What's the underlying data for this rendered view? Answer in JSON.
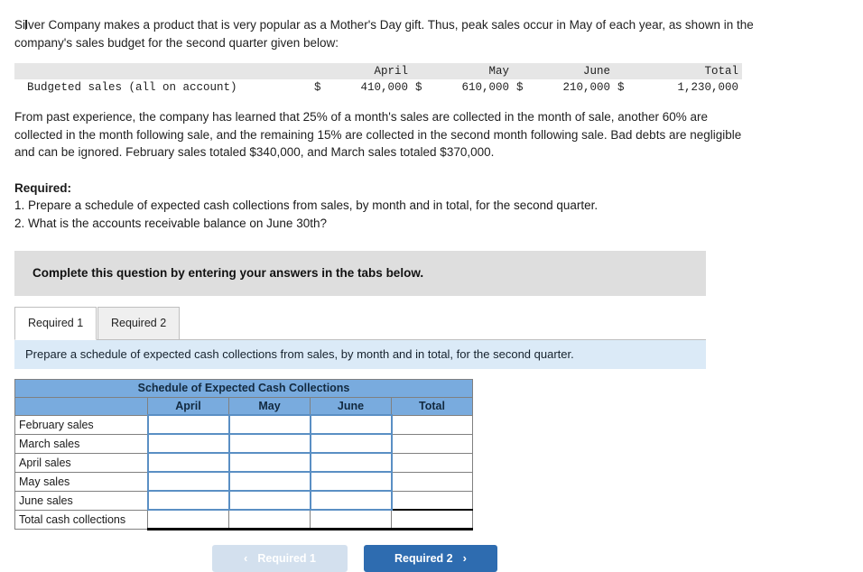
{
  "intro": {
    "paragraph1_a": "Si",
    "paragraph1_b": "lver Company makes a product that is very popular as a Mother's Day gift. Thus, peak sales occur in May of each year, as shown in the company's sales budget for the second quarter given below:",
    "paragraph2": "From past experience, the company has learned that 25% of a month's sales are collected in the month of sale, another 60% are collected in the month following sale, and the remaining 15% are collected in the second month following sale. Bad debts are negligible and can be ignored. February sales totaled $340,000, and March sales totaled $370,000."
  },
  "budget_table": {
    "headers": [
      "",
      "April",
      "May",
      "June",
      "Total"
    ],
    "row_label": "Budgeted sales (all on account)",
    "currency": "$",
    "values": [
      "410,000",
      "610,000",
      "210,000",
      "1,230,000"
    ]
  },
  "required": {
    "heading": "Required:",
    "item1": "1. Prepare a schedule of expected cash collections from sales, by month and in total, for the second quarter.",
    "item2": "2. What is the accounts receivable balance on June 30th?"
  },
  "banner": {
    "text": "Complete this question by entering your answers in the tabs below."
  },
  "tabs": {
    "active_index": 0,
    "items": [
      {
        "label": "Required 1"
      },
      {
        "label": "Required 2"
      }
    ]
  },
  "instruction": {
    "text": "Prepare a schedule of expected cash collections from sales, by month and in total, for the second quarter."
  },
  "schedule": {
    "title": "Schedule of Expected Cash Collections",
    "blank_header": "",
    "columns": [
      "April",
      "May",
      "June",
      "Total"
    ],
    "rows": [
      {
        "label": "February sales",
        "april": "",
        "may": "",
        "june": "",
        "total": ""
      },
      {
        "label": "March sales",
        "april": "",
        "may": "",
        "june": "",
        "total": ""
      },
      {
        "label": "April sales",
        "april": "",
        "may": "",
        "june": "",
        "total": ""
      },
      {
        "label": "May sales",
        "april": "",
        "may": "",
        "june": "",
        "total": ""
      },
      {
        "label": "June sales",
        "april": "",
        "may": "",
        "june": "",
        "total": ""
      }
    ],
    "total_row": {
      "label": "Total cash collections",
      "april": "",
      "may": "",
      "june": "",
      "total": ""
    }
  },
  "nav": {
    "prev_label": "Required 1",
    "prev_chevron": "‹",
    "next_label": "Required 2",
    "next_chevron": "›"
  },
  "colors": {
    "header_blue": "#79abde",
    "banner_grey": "#dedede",
    "instruction_blue": "#dbeaf7",
    "button_blue": "#2e6cb0",
    "button_disabled": "#d3e0ee",
    "cell_border_blue": "#5a8fc4"
  }
}
